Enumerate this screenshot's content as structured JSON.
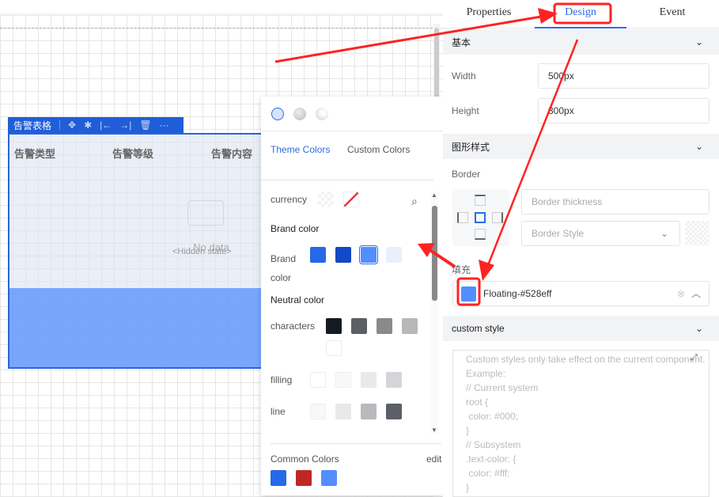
{
  "component": {
    "title": "告警表格",
    "columns": [
      "告警类型",
      "告警等级",
      "告警内容"
    ],
    "empty_text": "No data",
    "hidden_state": "<Hidden state>",
    "toolbar_icons": [
      "move-icon",
      "bug-icon",
      "align-left-icon",
      "align-right-icon",
      "delete-icon",
      "more-icon"
    ]
  },
  "picker": {
    "tabs": [
      "Theme Colors",
      "Custom Colors"
    ],
    "currency_label": "currency",
    "brand_section": "Brand color",
    "brand_label": "Brand color",
    "brand_colors": [
      "#2568ea",
      "#1348c6",
      "#528eff",
      "#e8f0fd"
    ],
    "neutral_section": "Neutral color",
    "characters_label": "characters",
    "characters_colors": [
      "#151b26",
      "#5c5f66",
      "#8a8a8a",
      "#b8b8b8",
      "#ffffff"
    ],
    "filling_label": "filling",
    "filling_colors": [
      "#ffffff",
      "#f7f8fa",
      "#e8e9eb",
      "#d4d5d8"
    ],
    "line_label": "line",
    "line_colors": [
      "#f7f8fa",
      "#e8e9eb",
      "#b8b9bd",
      "#5c5f66"
    ],
    "common_label": "Common Colors",
    "edit_label": "edit",
    "common_colors": [
      "#2568ea",
      "#c12626",
      "#528eff"
    ]
  },
  "panel": {
    "tabs": [
      "Properties",
      "Design",
      "Event"
    ],
    "section_basic": "基本",
    "width_label": "Width",
    "width_value": "500px",
    "height_label": "Height",
    "height_value": "300px",
    "section_shape": "图形样式",
    "border_label": "Border",
    "border_thickness_placeholder": "Border thickness",
    "border_style_placeholder": "Border Style",
    "fill_label": "填充",
    "fill_value": "Floating-#528eff",
    "fill_color": "#528eff",
    "section_custom": "custom style",
    "custom_placeholder": "Custom styles only take effect on the current component. Example:\n// Current system\nroot {\n color: #000;\n}\n// Subsystem\n.text-color: {\n color: #fff;\n}"
  }
}
